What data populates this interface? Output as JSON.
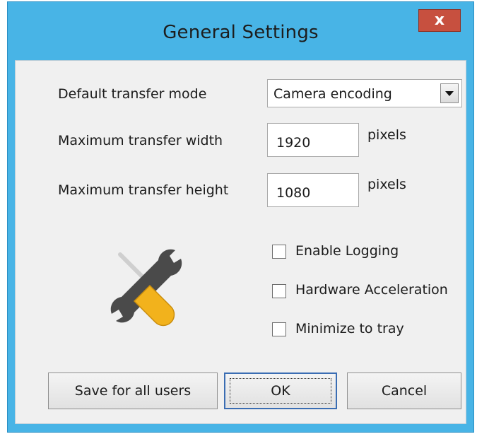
{
  "window": {
    "title": "General Settings",
    "close_symbol": "x"
  },
  "form": {
    "transfer_mode": {
      "label": "Default transfer mode",
      "selected": "Camera encoding"
    },
    "max_width": {
      "label": "Maximum transfer width",
      "value": "1920",
      "unit": "pixels"
    },
    "max_height": {
      "label": "Maximum transfer height",
      "value": "1080",
      "unit": "pixels"
    }
  },
  "options": [
    {
      "label": "Enable Logging",
      "checked": false
    },
    {
      "label": "Hardware Acceleration",
      "checked": false
    },
    {
      "label": "Minimize to tray",
      "checked": false
    }
  ],
  "buttons": {
    "save_all": "Save for all users",
    "ok": "OK",
    "cancel": "Cancel"
  },
  "icons": {
    "settings_tools": "wrench-screwdriver-icon",
    "dropdown": "chevron-down-icon",
    "close": "close-icon"
  },
  "colors": {
    "title_bar": "#48b4e6",
    "close_button": "#c7503f",
    "client_bg": "#f0f0f0",
    "wrench": "#4a4a4a",
    "screwdriver_handle": "#f2b21c"
  }
}
